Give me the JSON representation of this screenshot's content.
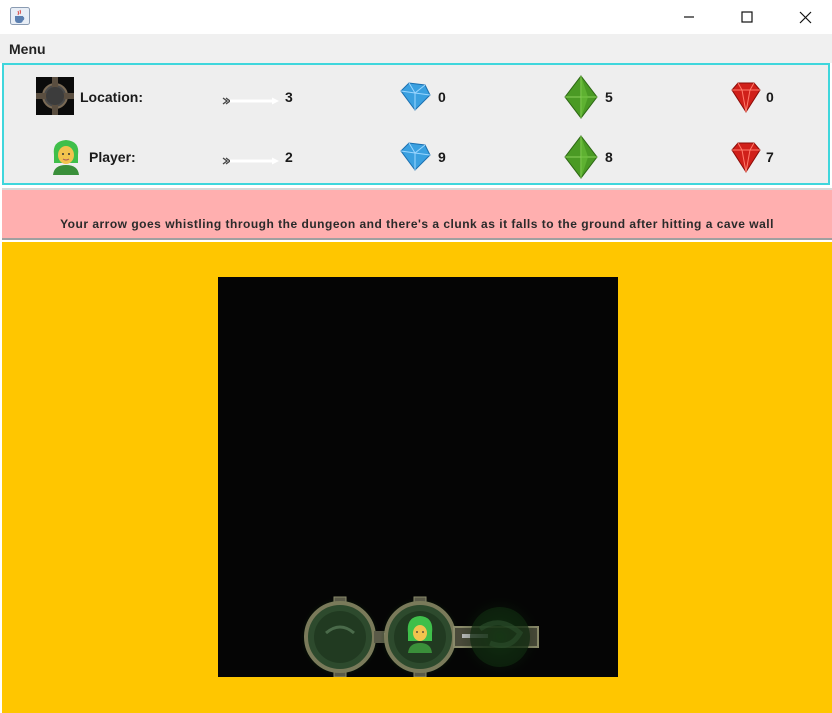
{
  "window": {
    "app_icon": "java-coffee-icon",
    "minimize_icon": "minimize-icon",
    "maximize_icon": "maximize-icon",
    "close_icon": "close-icon"
  },
  "menubar": {
    "menu_label": "Menu"
  },
  "stats": {
    "location": {
      "label": "Location:",
      "icon": "room-tile-icon",
      "arrows": "3",
      "blue_gems": "0",
      "green_gems": "5",
      "red_gems": "0"
    },
    "player": {
      "label": "Player:",
      "icon": "green-haired-player-icon",
      "arrows": "2",
      "blue_gems": "9",
      "green_gems": "8",
      "red_gems": "7"
    },
    "icons": {
      "arrow": "arrow-icon",
      "blue_gem": "blue-diamond-icon",
      "green_gem": "green-crystal-icon",
      "red_gem": "red-ruby-icon"
    }
  },
  "message": {
    "text": "Your arrow goes whistling through the dungeon and there's a clunk as it falls to the ground after hitting a cave wall"
  },
  "board": {
    "rooms": [
      {
        "name": "room-left",
        "state": "visited"
      },
      {
        "name": "room-player",
        "state": "occupied"
      },
      {
        "name": "room-right",
        "state": "faded"
      }
    ],
    "colors": {
      "background": "#ffc600",
      "board": "#050505",
      "room_glow": "#1f8a1f",
      "message_bg": "#ffafaf",
      "stats_border": "#3fd6dc"
    }
  }
}
